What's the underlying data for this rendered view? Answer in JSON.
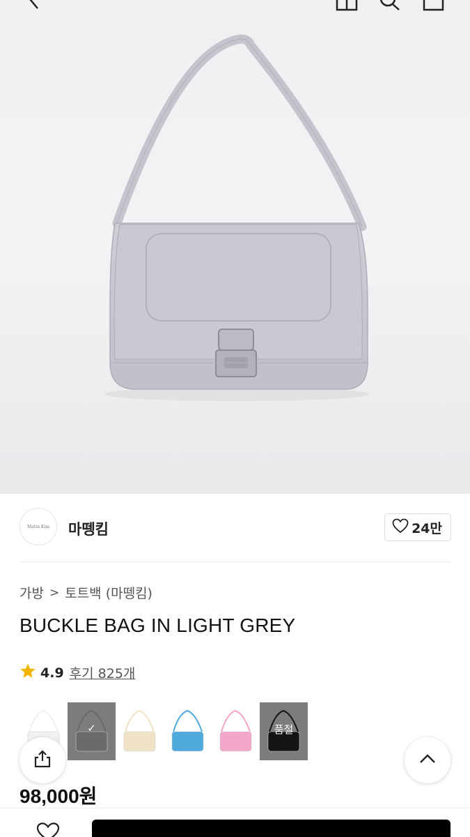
{
  "brand": {
    "name": "마뗑킴",
    "logo_text": "Matin Kim"
  },
  "like": {
    "count": "24만"
  },
  "breadcrumb": {
    "category": "가방",
    "separator": ">",
    "subcategory": "토트백 (마뗑킴)"
  },
  "product": {
    "title": "BUCKLE BAG IN LIGHT GREY",
    "rating": "4.9",
    "review_label": "후기 825개",
    "price": "98,000원"
  },
  "swatches": [
    {
      "color": "#f1f1f1",
      "state": "normal"
    },
    {
      "color": "#6a6a6a",
      "state": "selected",
      "mark": "✓"
    },
    {
      "color": "#efe2c6",
      "state": "normal"
    },
    {
      "color": "#4fa9dc",
      "state": "normal"
    },
    {
      "color": "#f3a6c8",
      "state": "normal"
    },
    {
      "color": "#141414",
      "state": "soldout",
      "mark": "품절"
    }
  ],
  "icons": {
    "back": "chevron-left-icon",
    "home": "home-icon",
    "search": "search-icon",
    "cart": "cart-icon",
    "heart": "heart-icon",
    "share": "share-icon",
    "scroll_top": "chevron-up-icon",
    "star": "star-icon"
  },
  "colors": {
    "star": "#f5b400",
    "bag": "#c9c6cf",
    "buy_button": "#000000"
  }
}
